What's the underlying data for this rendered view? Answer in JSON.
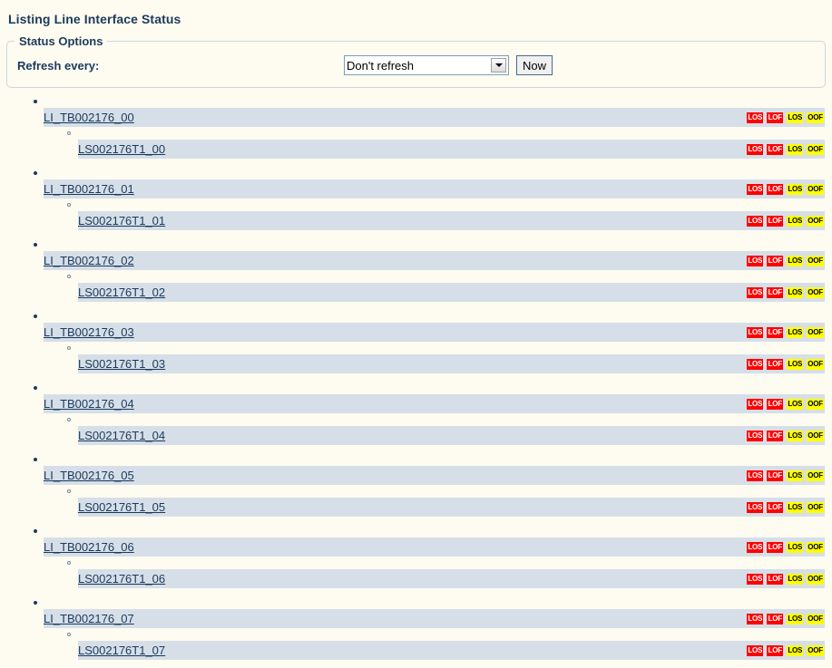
{
  "page": {
    "title": "Listing Line Interface Status"
  },
  "options": {
    "legend": "Status Options",
    "refresh_label": "Refresh every:",
    "refresh_selected": "Don't refresh",
    "refresh_options": [
      "Don't refresh"
    ],
    "now_button": "Now"
  },
  "colors": {
    "page_background": "#fefbf0",
    "row_background": "#d6dfe8",
    "title_color": "#1b3a5c",
    "alarm": "#ff0000",
    "warning": "#ffff00",
    "fieldset_border": "#cdd8e3"
  },
  "badge_set": [
    {
      "label": "LOS",
      "severity": "alarm"
    },
    {
      "label": "LOF",
      "severity": "alarm"
    },
    {
      "label": "LOS",
      "severity": "warn"
    },
    {
      "label": "OOF",
      "severity": "warn"
    }
  ],
  "interfaces": [
    {
      "name": "LI_TB002176_00",
      "badges": [
        {
          "label": "LOS",
          "severity": "alarm"
        },
        {
          "label": "LOF",
          "severity": "alarm"
        },
        {
          "label": "LOS",
          "severity": "warn"
        },
        {
          "label": "OOF",
          "severity": "warn"
        }
      ],
      "children": [
        {
          "name": "LS002176T1_00",
          "badges": [
            {
              "label": "LOS",
              "severity": "alarm"
            },
            {
              "label": "LOF",
              "severity": "alarm"
            },
            {
              "label": "LOS",
              "severity": "warn"
            },
            {
              "label": "OOF",
              "severity": "warn"
            }
          ]
        }
      ]
    },
    {
      "name": "LI_TB002176_01",
      "badges": [
        {
          "label": "LOS",
          "severity": "alarm"
        },
        {
          "label": "LOF",
          "severity": "alarm"
        },
        {
          "label": "LOS",
          "severity": "warn"
        },
        {
          "label": "OOF",
          "severity": "warn"
        }
      ],
      "children": [
        {
          "name": "LS002176T1_01",
          "badges": [
            {
              "label": "LOS",
              "severity": "alarm"
            },
            {
              "label": "LOF",
              "severity": "alarm"
            },
            {
              "label": "LOS",
              "severity": "warn"
            },
            {
              "label": "OOF",
              "severity": "warn"
            }
          ]
        }
      ]
    },
    {
      "name": "LI_TB002176_02",
      "badges": [
        {
          "label": "LOS",
          "severity": "alarm"
        },
        {
          "label": "LOF",
          "severity": "alarm"
        },
        {
          "label": "LOS",
          "severity": "warn"
        },
        {
          "label": "OOF",
          "severity": "warn"
        }
      ],
      "children": [
        {
          "name": "LS002176T1_02",
          "badges": [
            {
              "label": "LOS",
              "severity": "alarm"
            },
            {
              "label": "LOF",
              "severity": "alarm"
            },
            {
              "label": "LOS",
              "severity": "warn"
            },
            {
              "label": "OOF",
              "severity": "warn"
            }
          ]
        }
      ]
    },
    {
      "name": "LI_TB002176_03",
      "badges": [
        {
          "label": "LOS",
          "severity": "alarm"
        },
        {
          "label": "LOF",
          "severity": "alarm"
        },
        {
          "label": "LOS",
          "severity": "warn"
        },
        {
          "label": "OOF",
          "severity": "warn"
        }
      ],
      "children": [
        {
          "name": "LS002176T1_03",
          "badges": [
            {
              "label": "LOS",
              "severity": "alarm"
            },
            {
              "label": "LOF",
              "severity": "alarm"
            },
            {
              "label": "LOS",
              "severity": "warn"
            },
            {
              "label": "OOF",
              "severity": "warn"
            }
          ]
        }
      ]
    },
    {
      "name": "LI_TB002176_04",
      "badges": [
        {
          "label": "LOS",
          "severity": "alarm"
        },
        {
          "label": "LOF",
          "severity": "alarm"
        },
        {
          "label": "LOS",
          "severity": "warn"
        },
        {
          "label": "OOF",
          "severity": "warn"
        }
      ],
      "children": [
        {
          "name": "LS002176T1_04",
          "badges": [
            {
              "label": "LOS",
              "severity": "alarm"
            },
            {
              "label": "LOF",
              "severity": "alarm"
            },
            {
              "label": "LOS",
              "severity": "warn"
            },
            {
              "label": "OOF",
              "severity": "warn"
            }
          ]
        }
      ]
    },
    {
      "name": "LI_TB002176_05",
      "badges": [
        {
          "label": "LOS",
          "severity": "alarm"
        },
        {
          "label": "LOF",
          "severity": "alarm"
        },
        {
          "label": "LOS",
          "severity": "warn"
        },
        {
          "label": "OOF",
          "severity": "warn"
        }
      ],
      "children": [
        {
          "name": "LS002176T1_05",
          "badges": [
            {
              "label": "LOS",
              "severity": "alarm"
            },
            {
              "label": "LOF",
              "severity": "alarm"
            },
            {
              "label": "LOS",
              "severity": "warn"
            },
            {
              "label": "OOF",
              "severity": "warn"
            }
          ]
        }
      ]
    },
    {
      "name": "LI_TB002176_06",
      "badges": [
        {
          "label": "LOS",
          "severity": "alarm"
        },
        {
          "label": "LOF",
          "severity": "alarm"
        },
        {
          "label": "LOS",
          "severity": "warn"
        },
        {
          "label": "OOF",
          "severity": "warn"
        }
      ],
      "children": [
        {
          "name": "LS002176T1_06",
          "badges": [
            {
              "label": "LOS",
              "severity": "alarm"
            },
            {
              "label": "LOF",
              "severity": "alarm"
            },
            {
              "label": "LOS",
              "severity": "warn"
            },
            {
              "label": "OOF",
              "severity": "warn"
            }
          ]
        }
      ]
    },
    {
      "name": "LI_TB002176_07",
      "badges": [
        {
          "label": "LOS",
          "severity": "alarm"
        },
        {
          "label": "LOF",
          "severity": "alarm"
        },
        {
          "label": "LOS",
          "severity": "warn"
        },
        {
          "label": "OOF",
          "severity": "warn"
        }
      ],
      "children": [
        {
          "name": "LS002176T1_07",
          "badges": [
            {
              "label": "LOS",
              "severity": "alarm"
            },
            {
              "label": "LOF",
              "severity": "alarm"
            },
            {
              "label": "LOS",
              "severity": "warn"
            },
            {
              "label": "OOF",
              "severity": "warn"
            }
          ]
        }
      ]
    }
  ]
}
